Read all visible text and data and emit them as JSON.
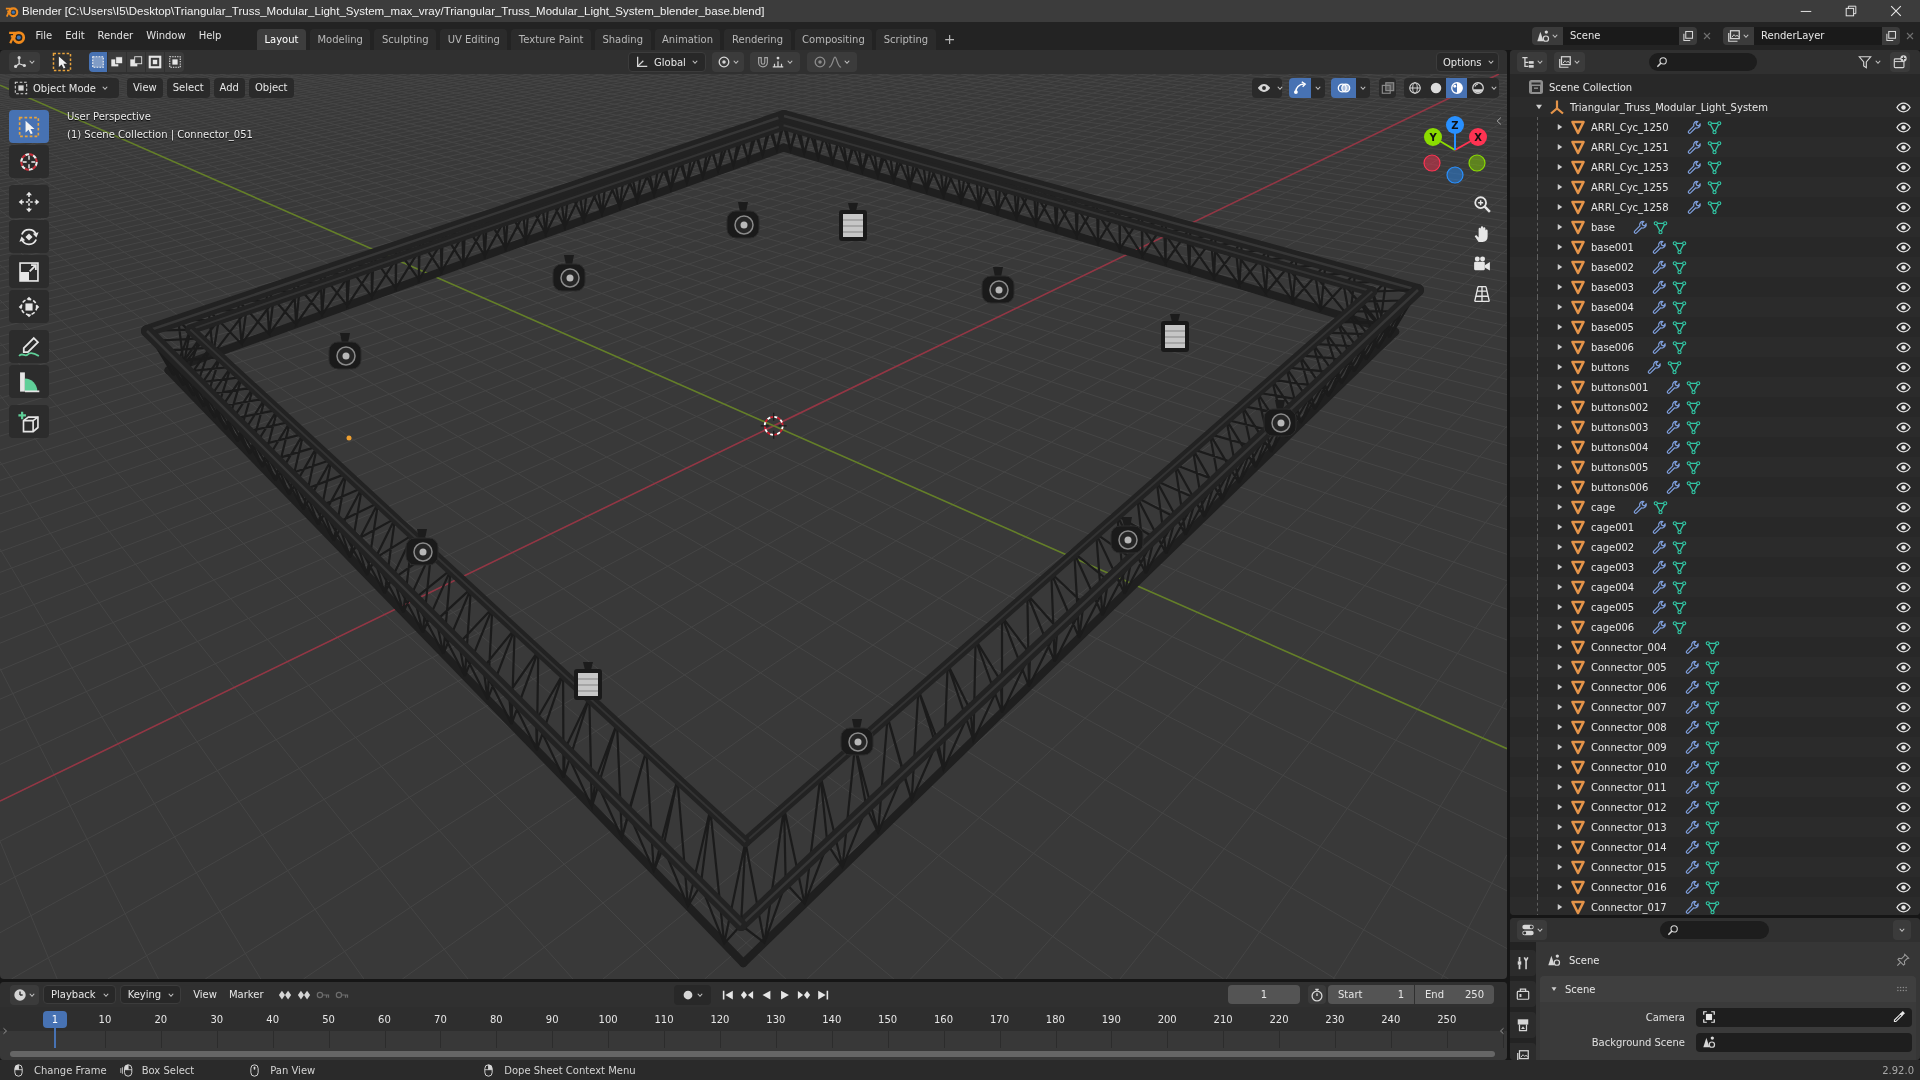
{
  "window": {
    "title": "Blender [C:\\Users\\I5\\Desktop\\Triangular_Truss_Modular_Light_System_max_vray/Triangular_Truss_Modular_Light_System_blender_base.blend]"
  },
  "menu": [
    "File",
    "Edit",
    "Render",
    "Window",
    "Help"
  ],
  "workspaces": [
    {
      "label": "Layout",
      "selected": true
    },
    {
      "label": "Modeling",
      "selected": false
    },
    {
      "label": "Sculpting",
      "selected": false
    },
    {
      "label": "UV Editing",
      "selected": false
    },
    {
      "label": "Texture Paint",
      "selected": false
    },
    {
      "label": "Shading",
      "selected": false
    },
    {
      "label": "Animation",
      "selected": false
    },
    {
      "label": "Rendering",
      "selected": false
    },
    {
      "label": "Compositing",
      "selected": false
    },
    {
      "label": "Scripting",
      "selected": false
    }
  ],
  "add_workspace": "+",
  "scene": {
    "value": "Scene"
  },
  "view_layer": {
    "value": "RenderLayer"
  },
  "tool_settings": {
    "select_modes": [
      {
        "kind": "set",
        "selected": true
      },
      {
        "kind": "extend",
        "selected": false
      },
      {
        "kind": "subtract",
        "selected": false
      },
      {
        "kind": "invert",
        "selected": false
      },
      {
        "kind": "intersect",
        "selected": false
      }
    ],
    "orientation": "Global",
    "snap": {
      "on": false
    },
    "proportional": {
      "on": false
    },
    "options": "Options"
  },
  "viewport": {
    "mode": "Object Mode",
    "menus": [
      "View",
      "Select",
      "Add",
      "Object"
    ],
    "gizmos": {
      "on": true
    },
    "overlays": {
      "on": true
    },
    "xray": {
      "on": false
    },
    "shading_modes": [
      {
        "kind": "wireframe",
        "selected": false
      },
      {
        "kind": "solid",
        "selected": false
      },
      {
        "kind": "material",
        "selected": true
      },
      {
        "kind": "rendered",
        "selected": false
      }
    ],
    "tools": [
      {
        "kind": "select_box",
        "selected": true
      },
      {
        "kind": "cursor",
        "selected": false
      },
      {
        "kind": "move",
        "selected": false
      },
      {
        "kind": "rotate",
        "selected": false
      },
      {
        "kind": "scale",
        "selected": false
      },
      {
        "kind": "transform",
        "selected": false
      },
      {
        "kind": "annotate",
        "selected": false
      },
      {
        "kind": "measure",
        "selected": false
      },
      {
        "kind": "add_cube",
        "selected": false
      }
    ],
    "info": [
      "User Perspective",
      "(1) Scene Collection | Connector_051"
    ],
    "gizmo_axes": [
      {
        "label": "X",
        "color": "#ff3352"
      },
      {
        "label": "Y",
        "color": "#8bdc00"
      },
      {
        "label": "Z",
        "color": "#2890ff"
      }
    ]
  },
  "outliner": {
    "tree": [
      {
        "name": "Scene Collection",
        "kind": "scene_collection",
        "children": [
          {
            "name": "Triangular_Truss_Modular_Light_System",
            "kind": "collection",
            "expanded": true,
            "visible": true,
            "children": [
              {
                "name": "ARRI_Cyc_1250",
                "kind": "mesh",
                "expanded": false,
                "visible": true
              },
              {
                "name": "ARRI_Cyc_1251",
                "kind": "mesh",
                "expanded": false,
                "visible": true
              },
              {
                "name": "ARRI_Cyc_1253",
                "kind": "mesh",
                "expanded": false,
                "visible": true
              },
              {
                "name": "ARRI_Cyc_1255",
                "kind": "mesh",
                "expanded": false,
                "visible": true
              },
              {
                "name": "ARRI_Cyc_1258",
                "kind": "mesh",
                "expanded": false,
                "visible": true
              },
              {
                "name": "base",
                "kind": "mesh",
                "expanded": false,
                "visible": true
              },
              {
                "name": "base001",
                "kind": "mesh",
                "expanded": false,
                "visible": true
              },
              {
                "name": "base002",
                "kind": "mesh",
                "expanded": false,
                "visible": true
              },
              {
                "name": "base003",
                "kind": "mesh",
                "expanded": false,
                "visible": true
              },
              {
                "name": "base004",
                "kind": "mesh",
                "expanded": false,
                "visible": true
              },
              {
                "name": "base005",
                "kind": "mesh",
                "expanded": false,
                "visible": true
              },
              {
                "name": "base006",
                "kind": "mesh",
                "expanded": false,
                "visible": true
              },
              {
                "name": "buttons",
                "kind": "mesh",
                "expanded": false,
                "visible": true
              },
              {
                "name": "buttons001",
                "kind": "mesh",
                "expanded": false,
                "visible": true
              },
              {
                "name": "buttons002",
                "kind": "mesh",
                "expanded": false,
                "visible": true
              },
              {
                "name": "buttons003",
                "kind": "mesh",
                "expanded": false,
                "visible": true
              },
              {
                "name": "buttons004",
                "kind": "mesh",
                "expanded": false,
                "visible": true
              },
              {
                "name": "buttons005",
                "kind": "mesh",
                "expanded": false,
                "visible": true
              },
              {
                "name": "buttons006",
                "kind": "mesh",
                "expanded": false,
                "visible": true
              },
              {
                "name": "cage",
                "kind": "mesh",
                "expanded": false,
                "visible": true
              },
              {
                "name": "cage001",
                "kind": "mesh",
                "expanded": false,
                "visible": true
              },
              {
                "name": "cage002",
                "kind": "mesh",
                "expanded": false,
                "visible": true
              },
              {
                "name": "cage003",
                "kind": "mesh",
                "expanded": false,
                "visible": true
              },
              {
                "name": "cage004",
                "kind": "mesh",
                "expanded": false,
                "visible": true
              },
              {
                "name": "cage005",
                "kind": "mesh",
                "expanded": false,
                "visible": true
              },
              {
                "name": "cage006",
                "kind": "mesh",
                "expanded": false,
                "visible": true
              },
              {
                "name": "Connector_004",
                "kind": "mesh",
                "expanded": false,
                "visible": true
              },
              {
                "name": "Connector_005",
                "kind": "mesh",
                "expanded": false,
                "visible": true
              },
              {
                "name": "Connector_006",
                "kind": "mesh",
                "expanded": false,
                "visible": true
              },
              {
                "name": "Connector_007",
                "kind": "mesh",
                "expanded": false,
                "visible": true
              },
              {
                "name": "Connector_008",
                "kind": "mesh",
                "expanded": false,
                "visible": true
              },
              {
                "name": "Connector_009",
                "kind": "mesh",
                "expanded": false,
                "visible": true
              },
              {
                "name": "Connector_010",
                "kind": "mesh",
                "expanded": false,
                "visible": true
              },
              {
                "name": "Connector_011",
                "kind": "mesh",
                "expanded": false,
                "visible": true
              },
              {
                "name": "Connector_012",
                "kind": "mesh",
                "expanded": false,
                "visible": true
              },
              {
                "name": "Connector_013",
                "kind": "mesh",
                "expanded": false,
                "visible": true
              },
              {
                "name": "Connector_014",
                "kind": "mesh",
                "expanded": false,
                "visible": true
              },
              {
                "name": "Connector_015",
                "kind": "mesh",
                "expanded": false,
                "visible": true
              },
              {
                "name": "Connector_016",
                "kind": "mesh",
                "expanded": false,
                "visible": true
              },
              {
                "name": "Connector_017",
                "kind": "mesh",
                "expanded": false,
                "visible": true
              }
            ]
          }
        ]
      }
    ]
  },
  "properties": {
    "tabs": [
      {
        "kind": "tool",
        "selected": false
      },
      {
        "kind": "render",
        "selected": false
      },
      {
        "kind": "output",
        "selected": false
      },
      {
        "kind": "view_layer",
        "selected": false
      }
    ],
    "context": "Scene",
    "panel": {
      "title": "Scene",
      "expanded": true,
      "fields": [
        {
          "label": "Camera",
          "kind": "camera"
        },
        {
          "label": "Background Scene",
          "kind": "scene"
        }
      ]
    }
  },
  "timeline": {
    "menus": [
      {
        "label": "Playback",
        "kind": "popover"
      },
      {
        "label": "Keying",
        "kind": "popover"
      },
      {
        "label": "View",
        "kind": "menu"
      },
      {
        "label": "Marker",
        "kind": "menu"
      }
    ],
    "current_frame": "1",
    "start_label": "Start",
    "start": "1",
    "end_label": "End",
    "end": "250",
    "playhead": "1",
    "ruler": [
      "10",
      "20",
      "30",
      "40",
      "50",
      "60",
      "70",
      "80",
      "90",
      "100",
      "110",
      "120",
      "130",
      "140",
      "150",
      "160",
      "170",
      "180",
      "190",
      "200",
      "210",
      "220",
      "230",
      "240",
      "250"
    ]
  },
  "status_bar": {
    "hints": [
      {
        "kind": "left_click",
        "label": "Change Frame"
      },
      {
        "kind": "left_drag",
        "label": "Box Select"
      },
      {
        "kind": "middle_click",
        "label": "Pan View"
      },
      {
        "kind": "right_click",
        "label": "Dope Sheet Context Menu"
      }
    ],
    "version": "2.92.0"
  }
}
